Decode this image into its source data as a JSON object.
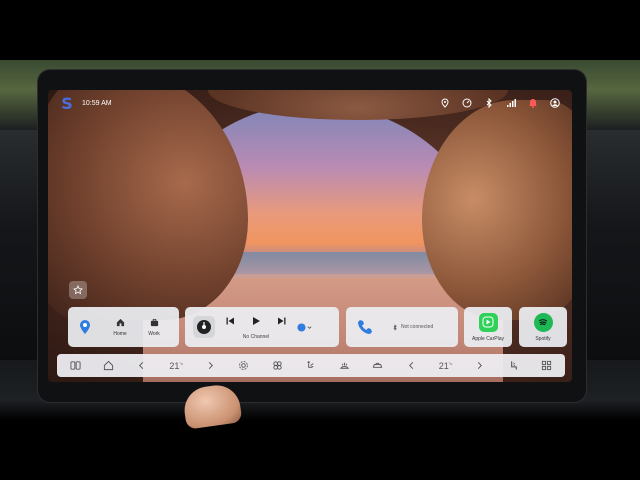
{
  "statusbar": {
    "time": "10:59 AM",
    "icons": [
      "location-icon",
      "gauge-icon",
      "bluetooth-icon",
      "signal-icon",
      "bell-icon",
      "user-icon"
    ]
  },
  "nav": {
    "home_label": "Home",
    "work_label": "Work"
  },
  "media": {
    "channel_label": "No Channel"
  },
  "phone": {
    "status": "Not connected"
  },
  "apps": {
    "carplay_label": "Apple CarPlay",
    "spotify_label": "Spotify"
  },
  "dock": {
    "left_temp": "21",
    "right_temp": "21",
    "temp_unit": "°c"
  },
  "colors": {
    "accent_blue": "#2f7de1",
    "carplay_green": "#2fd158",
    "spotify_green": "#1db954",
    "alert_red": "#ff5a5a"
  }
}
